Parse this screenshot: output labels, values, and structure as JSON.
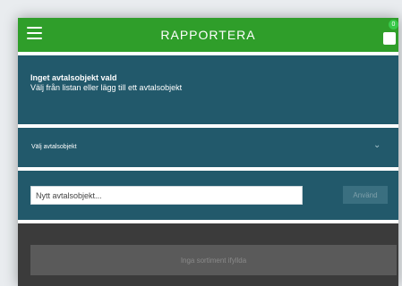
{
  "header": {
    "title": "RAPPORTERA",
    "menu_icon": "hamburger-menu-icon",
    "cart_icon": "shopping-bag-icon",
    "cart_count": "0",
    "color": "#2f9e2a"
  },
  "info": {
    "title": "Inget avtalsobjekt vald",
    "subtitle": "Välj från listan eller lägg till ett avtalsobjekt",
    "color": "#22596b"
  },
  "select": {
    "label": "Välj avtalsobjekt",
    "icon": "chevron-down-icon"
  },
  "add_object": {
    "placeholder": "Nytt avtalsobjekt...",
    "button_label": "Använd"
  },
  "assortment": {
    "button_label": "Inga sortiment ifyllda"
  }
}
